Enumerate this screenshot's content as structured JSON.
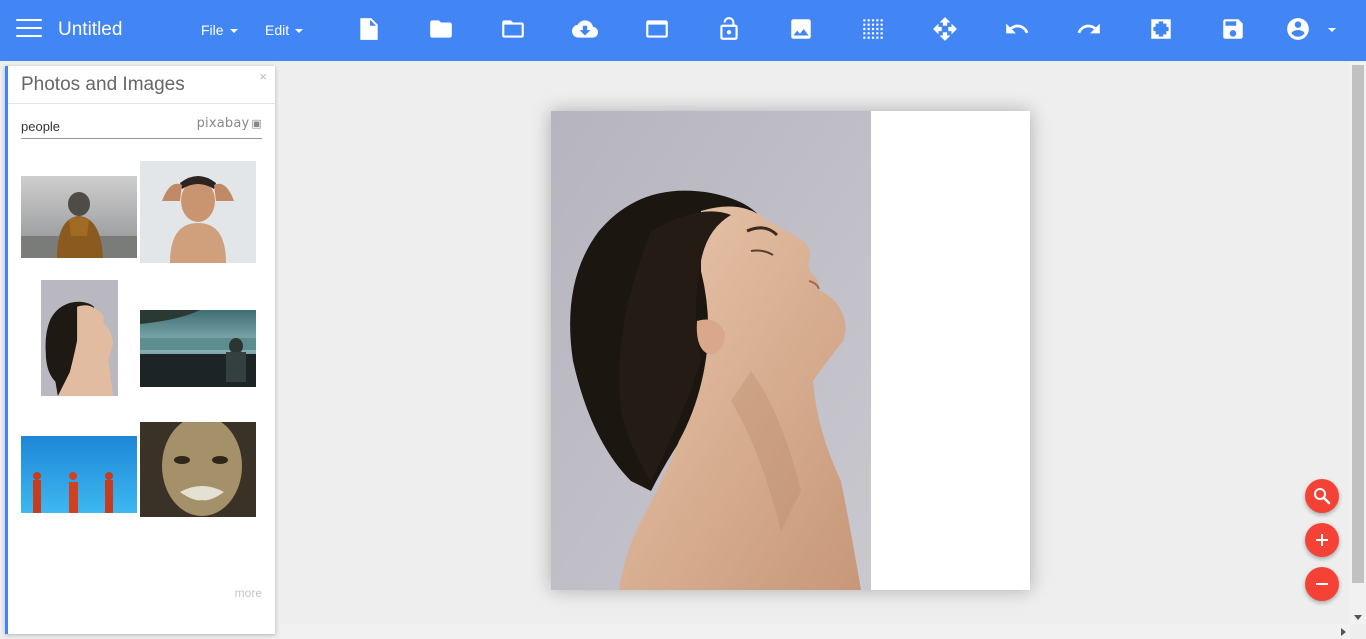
{
  "app": {
    "title": "Untitled",
    "accent_color": "#4285f4",
    "fab_color": "#f44336"
  },
  "menu": {
    "file_label": "File",
    "edit_label": "Edit"
  },
  "toolbar": {
    "icons": [
      "new-file-icon",
      "folder-icon",
      "folder-open-icon",
      "cloud-download-icon",
      "window-icon",
      "lock-open-icon",
      "image-icon",
      "grid-icon",
      "move-icon",
      "undo-icon",
      "redo-icon",
      "fullscreen-icon",
      "save-icon",
      "account-icon"
    ]
  },
  "panel": {
    "title": "Photos and Images",
    "close_label": "×",
    "search_value": "people",
    "provider": "pixabay",
    "more_label": "more",
    "thumbnails": [
      "person-in-hood-back",
      "man-hands-on-head",
      "man-profile-looking-up",
      "person-lake-view",
      "red-figures-blue-sky",
      "old-man-portrait"
    ]
  },
  "canvas": {
    "photo": "man-profile-looking-up"
  },
  "fabs": [
    "zoom-search-icon",
    "zoom-in-icon",
    "zoom-out-icon"
  ]
}
